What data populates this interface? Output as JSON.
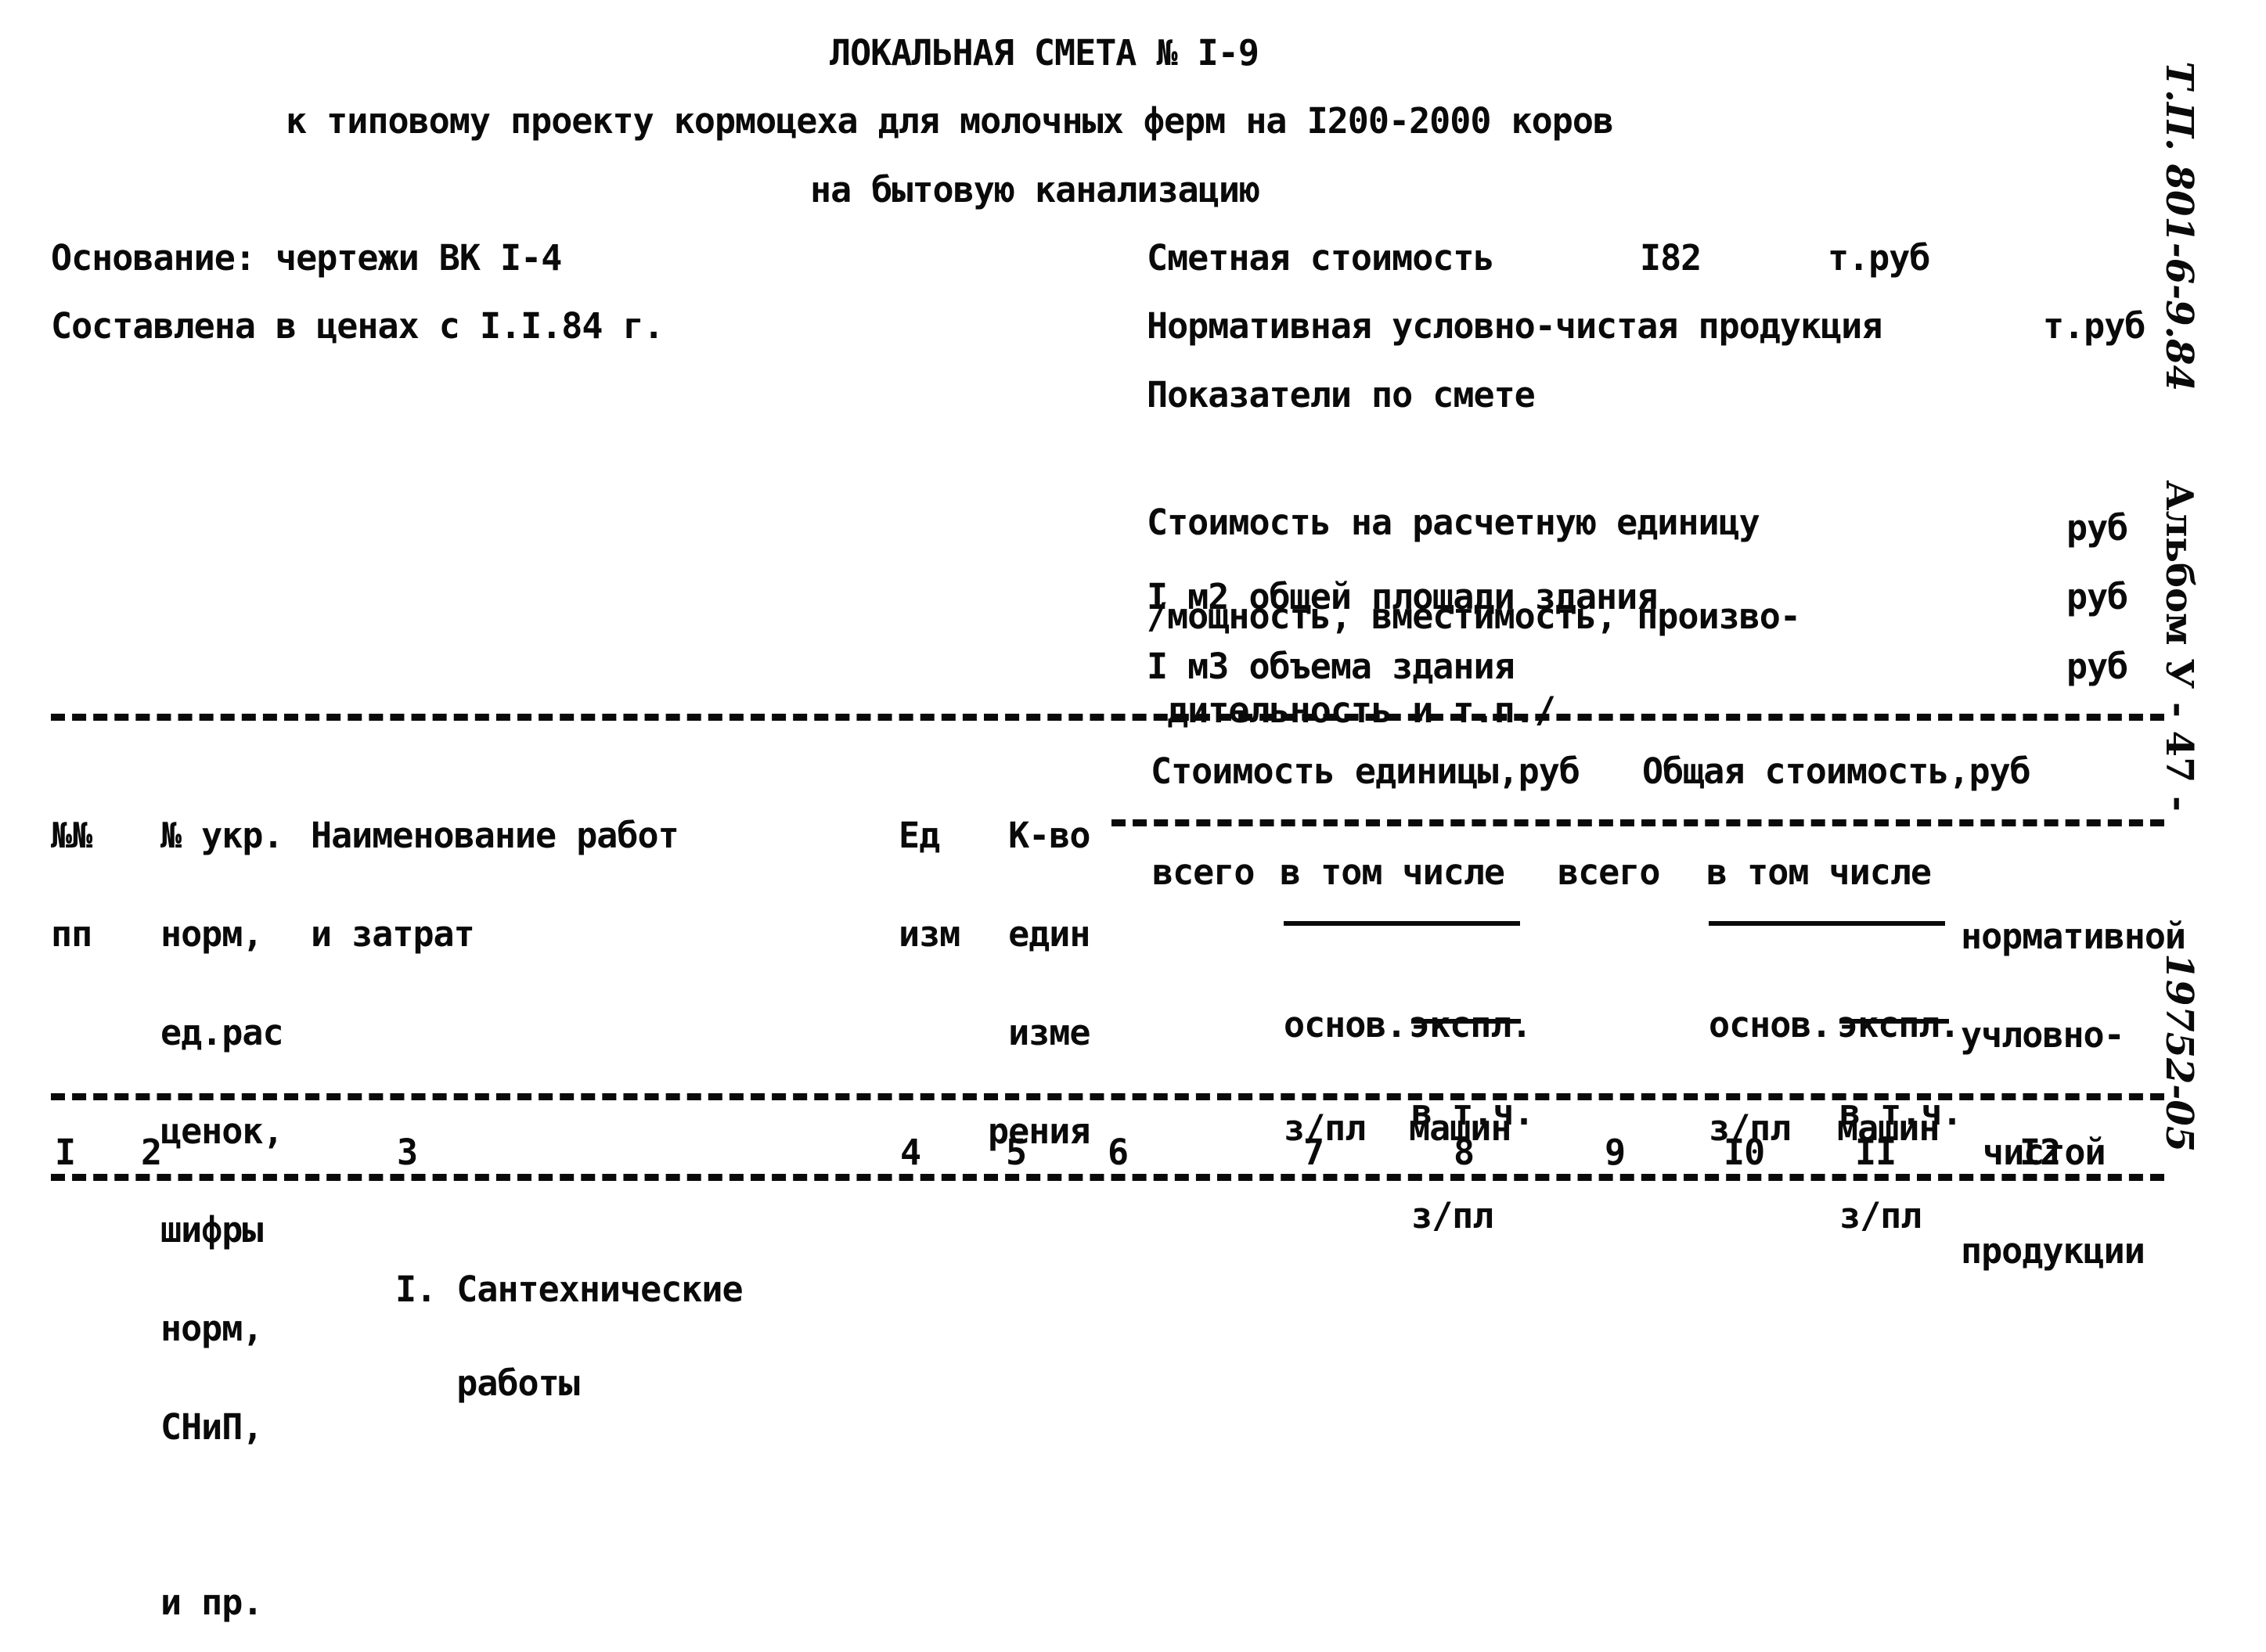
{
  "document": {
    "title": "ЛОКАЛЬНАЯ СМЕТА № I-9",
    "subtitle_line1": "к типовому проекту кормоцеха для молочных ферм на I200-2000 коров",
    "subtitle_line2": "на бытовую канализацию"
  },
  "basis": {
    "foundation": "Основание: чертежи ВК I-4",
    "prices": "Составлена в ценах с I.I.84 г."
  },
  "summary": {
    "estimated_cost_label": "Сметная стоимость",
    "estimated_cost_value": "I82",
    "estimated_cost_unit": "т.руб",
    "normative_label": "Нормативная условно-чистая продукция",
    "normative_unit": "т.руб",
    "indicators_label": "Показатели по смете",
    "unit_cost_line1": "Стоимость на расчетную единицу",
    "unit_cost_line2": "/мощность, вместимость, произво-",
    "unit_cost_line3": " дительность и т.п./",
    "unit_cost_unit": "руб",
    "area_label": "I м2 общей площади здания",
    "area_unit": "руб",
    "volume_label": "I м3 объема здания",
    "volume_unit": "руб"
  },
  "margin": {
    "project_code": "Т.П. 801-6-9.84",
    "album": "Альбом У - 47 -",
    "doc_number": "19752-05"
  },
  "table": {
    "headers": {
      "col1": [
        "№№",
        "пп"
      ],
      "col2": [
        "№ укр.",
        "норм,",
        "ед.рас",
        "ценок,",
        "шифры",
        "норм,",
        "СНиП,",
        "",
        "и пр."
      ],
      "col3": [
        "Наименование работ",
        "и затрат"
      ],
      "col4": [
        "Ед",
        "изм"
      ],
      "col5": [
        "К-во",
        "един",
        "изме",
        "рения"
      ],
      "unit_cost_group": "Стоимость единицы,руб",
      "total_cost_group": "Общая стоимость,руб",
      "total": "всего",
      "including": "в том числе",
      "basic_wage": [
        "основ.",
        "з/пл"
      ],
      "machines": [
        "экспл.",
        "машин"
      ],
      "incl_wage": [
        "в т.ч.",
        "з/пл"
      ],
      "normative": [
        "нормативной",
        "учловно-",
        "чистой",
        "продукции"
      ]
    },
    "column_numbers": [
      "I",
      "2",
      "3",
      "4",
      "5",
      "6",
      "7",
      "8",
      "9",
      "I0",
      "II",
      "I2"
    ],
    "sections": [
      {
        "title_line1": "I. Сантехнические",
        "title_line2": "   работы"
      }
    ]
  }
}
